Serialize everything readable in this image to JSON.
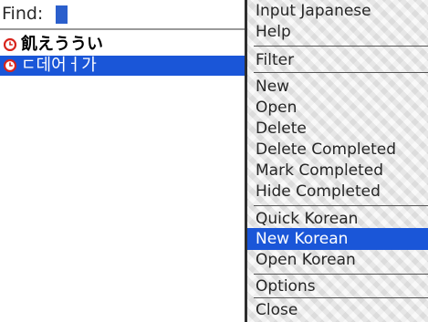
{
  "find": {
    "label": "Find:"
  },
  "tasks": [
    {
      "text": "飢えううい",
      "icon": "alarm-clock-icon",
      "selected": false
    },
    {
      "text": "ㄷ데어ㅓ가",
      "icon": "alarm-clock-icon",
      "selected": true
    }
  ],
  "menu": {
    "items": [
      {
        "label": "Input Japanese"
      },
      {
        "label": "Help"
      },
      {
        "label": "Filter"
      },
      {
        "label": "New"
      },
      {
        "label": "Open"
      },
      {
        "label": "Delete"
      },
      {
        "label": "Delete Completed"
      },
      {
        "label": "Mark Completed"
      },
      {
        "label": "Hide Completed"
      },
      {
        "label": "Quick Korean"
      },
      {
        "label": "New Korean",
        "selected": true
      },
      {
        "label": "Open Korean"
      },
      {
        "label": "Options"
      },
      {
        "label": "Close"
      }
    ]
  },
  "colors": {
    "selection": "#1a56d8",
    "menu_background": "#e9e9e9",
    "menu_text": "#262626",
    "icon_red": "#d8241c"
  }
}
